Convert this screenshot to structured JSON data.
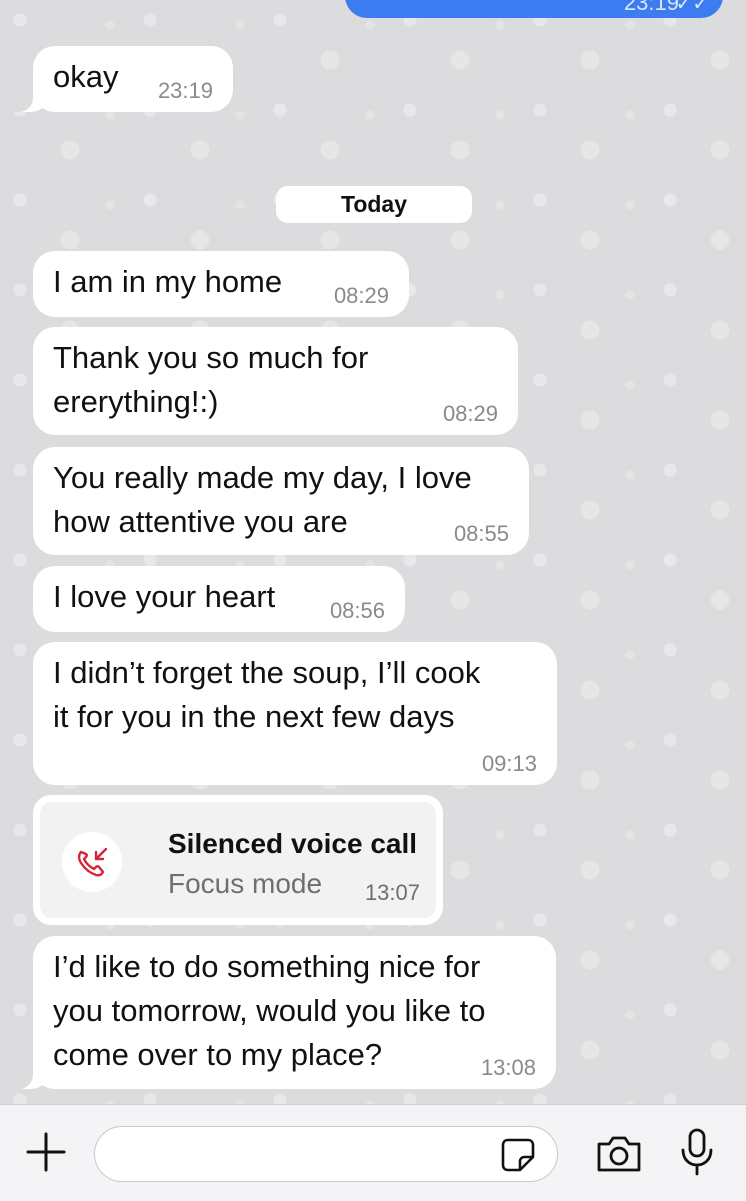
{
  "top_outgoing": {
    "time": "23:19",
    "ticks": "✓✓"
  },
  "date_separator": "Today",
  "messages": [
    {
      "text": "okay",
      "time": "23:19"
    },
    {
      "text": "I am in my home",
      "time": "08:29"
    },
    {
      "line1": "Thank you so much for",
      "line2": "ererything!:)",
      "time": "08:29"
    },
    {
      "line1": "You really made my day, I love",
      "line2": "how attentive you are",
      "time": "08:55"
    },
    {
      "text": "I love your heart",
      "time": "08:56"
    },
    {
      "line1": "I didn’t forget the soup, I’ll cook",
      "line2": "it for you in the next few days",
      "time": "09:13"
    },
    {
      "line1": "I’d like to do something nice for",
      "line2": "you tomorrow, would you like to",
      "line3": "come over to my place?",
      "time": "13:08"
    }
  ],
  "call": {
    "title": "Silenced voice call",
    "subtitle": "Focus mode",
    "time": "13:07",
    "icon": "missed-call-icon",
    "icon_color": "#d6253a"
  },
  "input_bar": {
    "placeholder": "",
    "icons": [
      "plus-icon",
      "sticker-icon",
      "camera-icon",
      "microphone-icon"
    ]
  },
  "colors": {
    "outgoing": "#3c7cf0",
    "incoming": "#ffffff",
    "background": "#dcdcde"
  }
}
